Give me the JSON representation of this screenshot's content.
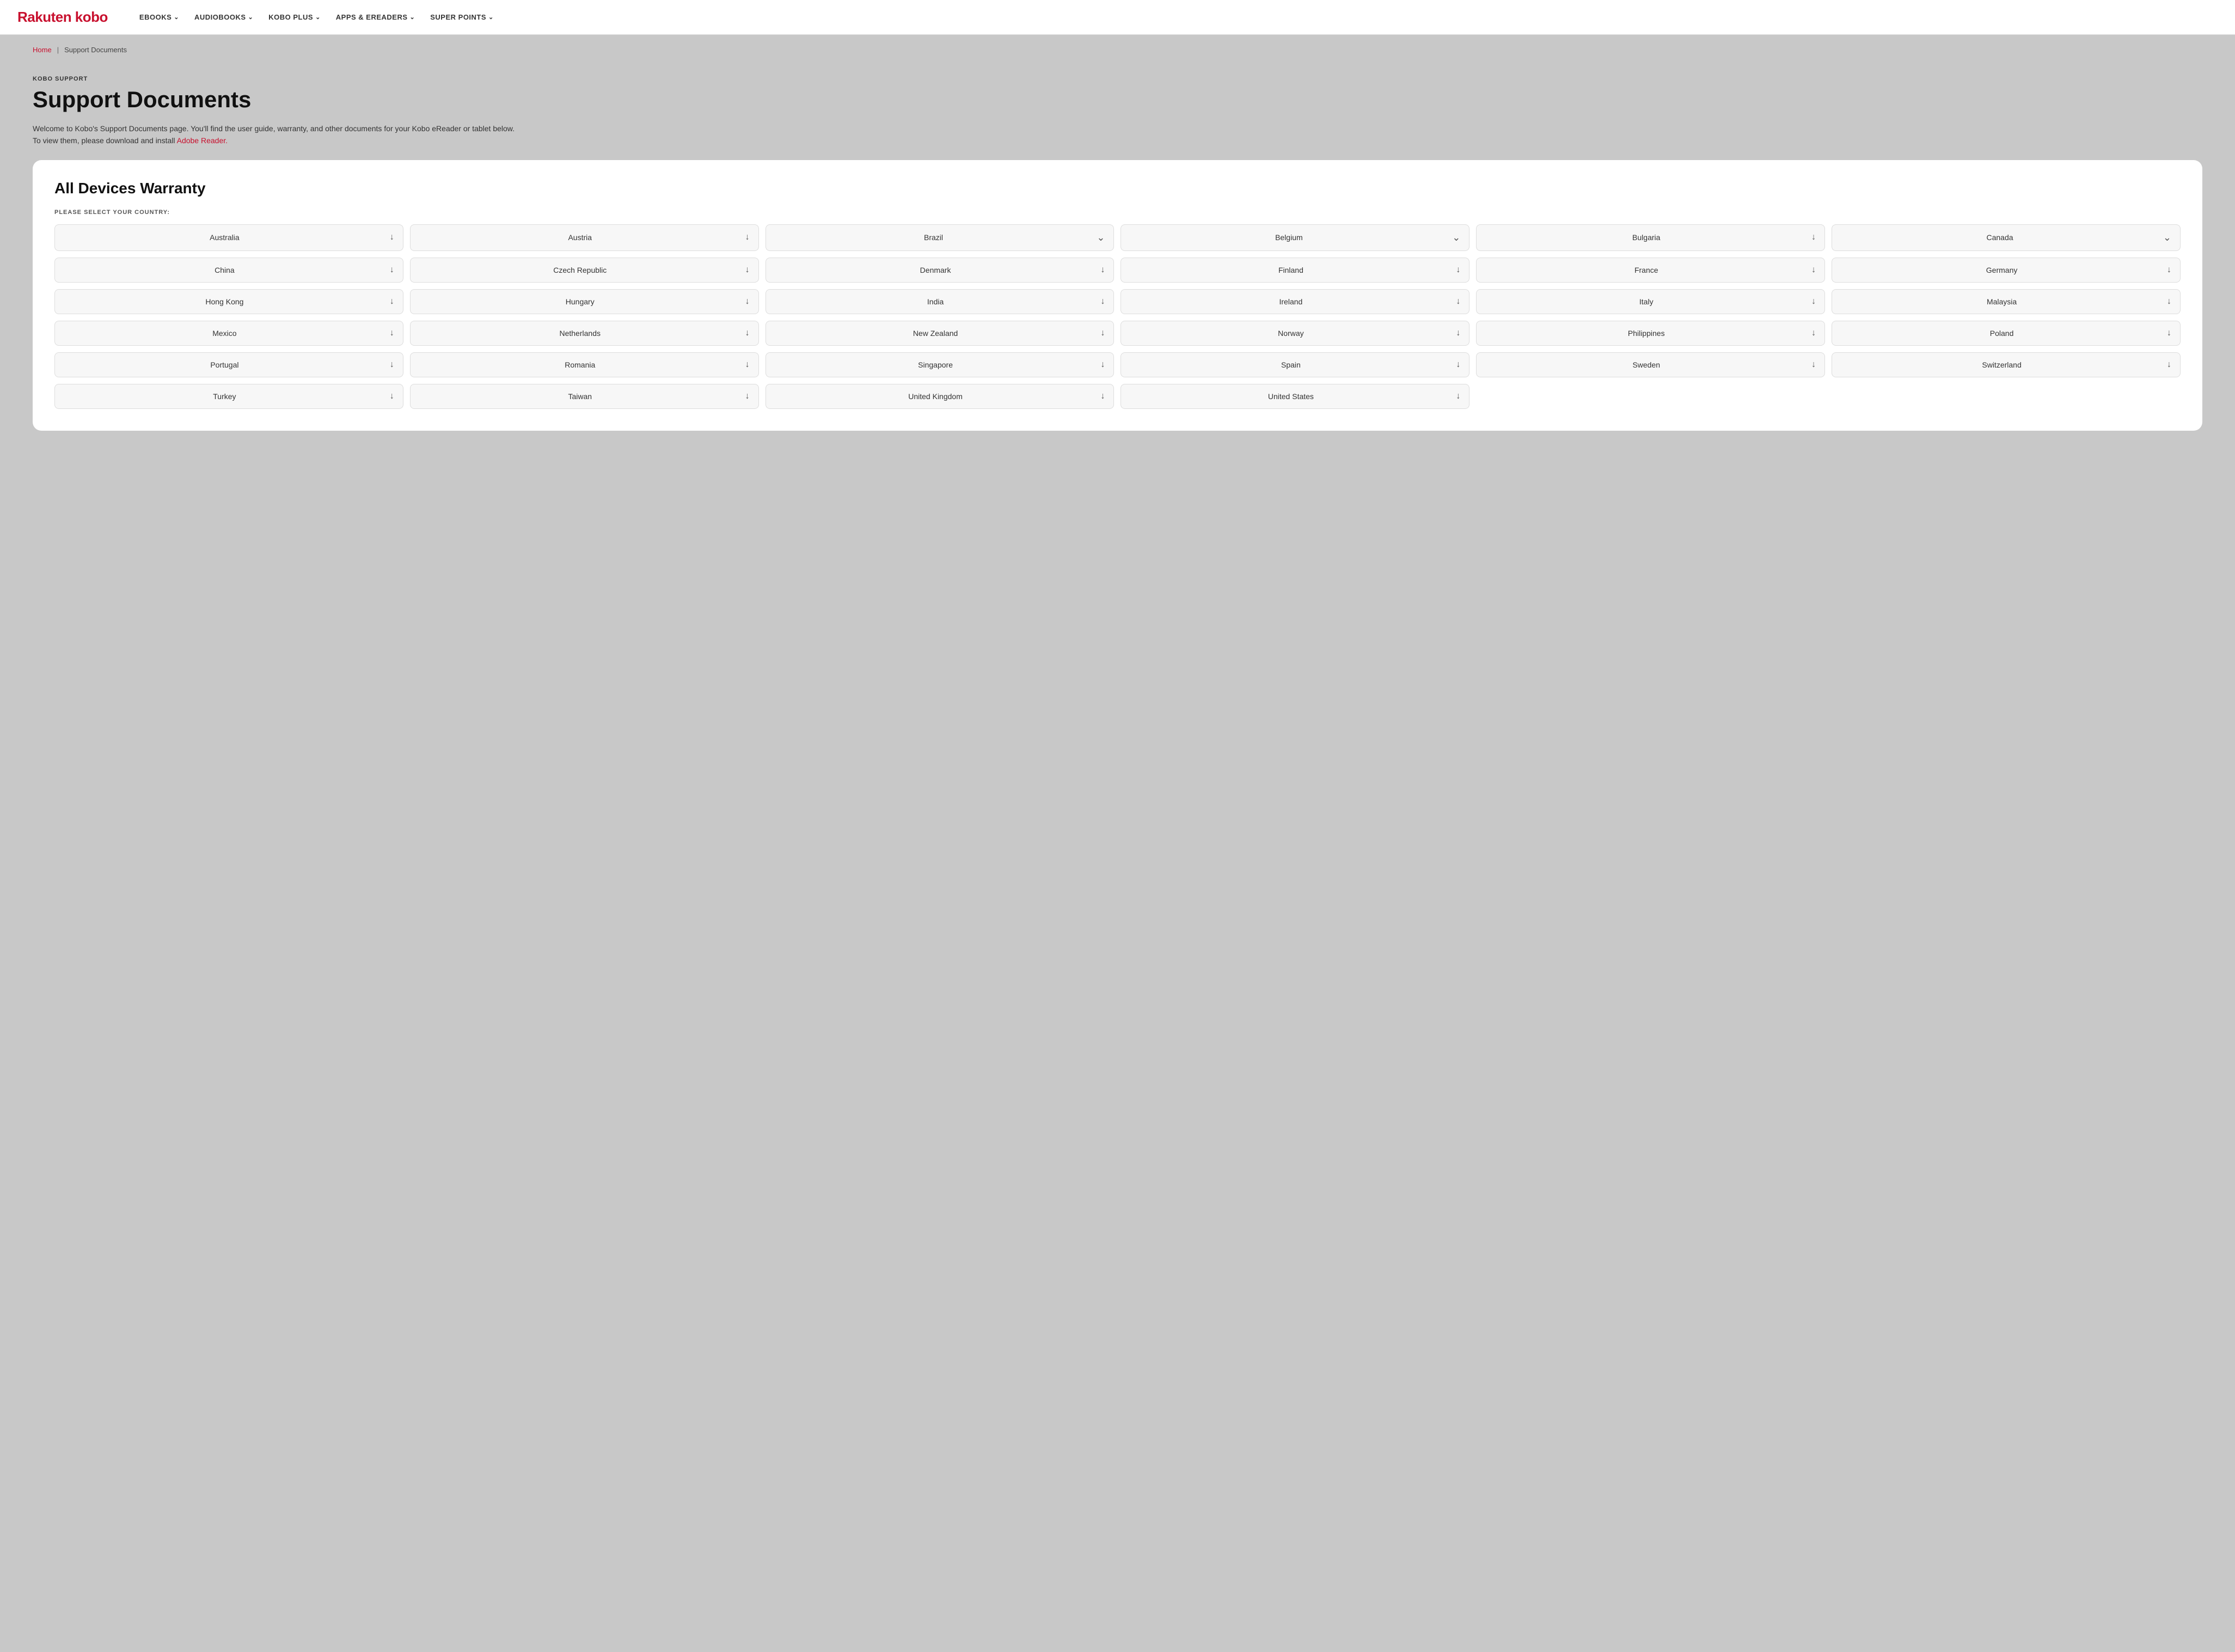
{
  "nav": {
    "logo": "Rakuten kobo",
    "items": [
      {
        "label": "eBOOKS",
        "hasDropdown": true
      },
      {
        "label": "AUDIOBOOKS",
        "hasDropdown": true
      },
      {
        "label": "KOBO PLUS",
        "hasDropdown": true
      },
      {
        "label": "APPS & eREADERS",
        "hasDropdown": true
      },
      {
        "label": "SUPER POINTS",
        "hasDropdown": true
      }
    ]
  },
  "breadcrumb": {
    "home": "Home",
    "separator": "|",
    "current": "Support Documents"
  },
  "page": {
    "label": "KOBO SUPPORT",
    "title": "Support Documents",
    "desc_before_link": "Welcome to Kobo's Support Documents page. You'll find the user guide, warranty, and other documents for your Kobo eReader or tablet below.\nTo view them, please download and install ",
    "link_text": "Adobe Reader.",
    "desc_after_link": ""
  },
  "card": {
    "title": "All Devices Warranty",
    "select_label": "PLEASE SELECT YOUR COUNTRY:",
    "countries": [
      {
        "name": "Australia",
        "icon": "download"
      },
      {
        "name": "Austria",
        "icon": "download"
      },
      {
        "name": "Brazil",
        "icon": "expand"
      },
      {
        "name": "Belgium",
        "icon": "expand"
      },
      {
        "name": "Bulgaria",
        "icon": "download"
      },
      {
        "name": "Canada",
        "icon": "expand"
      },
      {
        "name": "China",
        "icon": "download"
      },
      {
        "name": "Czech Republic",
        "icon": "download"
      },
      {
        "name": "Denmark",
        "icon": "download"
      },
      {
        "name": "Finland",
        "icon": "download"
      },
      {
        "name": "France",
        "icon": "download"
      },
      {
        "name": "Germany",
        "icon": "download"
      },
      {
        "name": "Hong Kong",
        "icon": "download"
      },
      {
        "name": "Hungary",
        "icon": "download"
      },
      {
        "name": "India",
        "icon": "download"
      },
      {
        "name": "Ireland",
        "icon": "download"
      },
      {
        "name": "Italy",
        "icon": "download"
      },
      {
        "name": "Malaysia",
        "icon": "download"
      },
      {
        "name": "Mexico",
        "icon": "download"
      },
      {
        "name": "Netherlands",
        "icon": "download"
      },
      {
        "name": "New Zealand",
        "icon": "download"
      },
      {
        "name": "Norway",
        "icon": "download"
      },
      {
        "name": "Philippines",
        "icon": "download"
      },
      {
        "name": "Poland",
        "icon": "download"
      },
      {
        "name": "Portugal",
        "icon": "download"
      },
      {
        "name": "Romania",
        "icon": "download"
      },
      {
        "name": "Singapore",
        "icon": "download"
      },
      {
        "name": "Spain",
        "icon": "download"
      },
      {
        "name": "Sweden",
        "icon": "download"
      },
      {
        "name": "Switzerland",
        "icon": "download"
      },
      {
        "name": "Turkey",
        "icon": "download"
      },
      {
        "name": "Taiwan",
        "icon": "download"
      },
      {
        "name": "United Kingdom",
        "icon": "download"
      },
      {
        "name": "United States",
        "icon": "download"
      }
    ]
  }
}
